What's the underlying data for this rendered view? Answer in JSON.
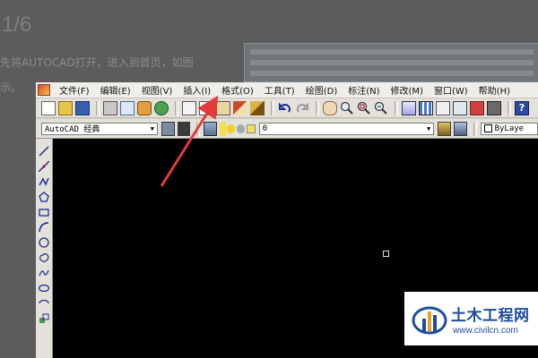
{
  "doc": {
    "step": "1/6",
    "line1": "先将AUTOCAD打开，进入到首页，如图",
    "line2": "示。"
  },
  "app": {
    "menu": [
      "文件(F)",
      "编辑(E)",
      "视图(V)",
      "插入(I)",
      "格式(O)",
      "工具(T)",
      "绘图(D)",
      "标注(N)",
      "修改(M)",
      "窗口(W)",
      "帮助(H)"
    ],
    "workspace": "AutoCAD 经典",
    "layer": "0",
    "linetype": "ByLaye"
  },
  "icons": {
    "toolbar": [
      "new-icon",
      "open-icon",
      "save-icon",
      "print-icon",
      "preview-icon",
      "publish-icon",
      "plot-icon",
      "cut-icon",
      "copy-icon",
      "paste-icon",
      "match-properties-icon",
      "block-editor-icon",
      "undo-icon",
      "redo-icon",
      "pan-icon",
      "zoom-realtime-icon",
      "zoom-window-icon",
      "zoom-previous-icon",
      "properties-icon",
      "design-center-icon",
      "tool-palettes-icon",
      "sheet-set-icon",
      "markup-icon",
      "calculator-icon",
      "help-icon"
    ],
    "draw": [
      "line-icon",
      "construction-line-icon",
      "polyline-icon",
      "polygon-icon",
      "rectangle-icon",
      "arc-icon",
      "circle-icon",
      "revision-cloud-icon",
      "spline-icon",
      "ellipse-icon",
      "ellipse-arc-icon",
      "insert-block-icon"
    ]
  },
  "colors": {
    "annotation_arrow": "#e23b3b",
    "canvas": "#000000",
    "brand": "#1f4e9a"
  },
  "watermark": {
    "name": "土木工程网",
    "url": "www.civilcn.com"
  }
}
